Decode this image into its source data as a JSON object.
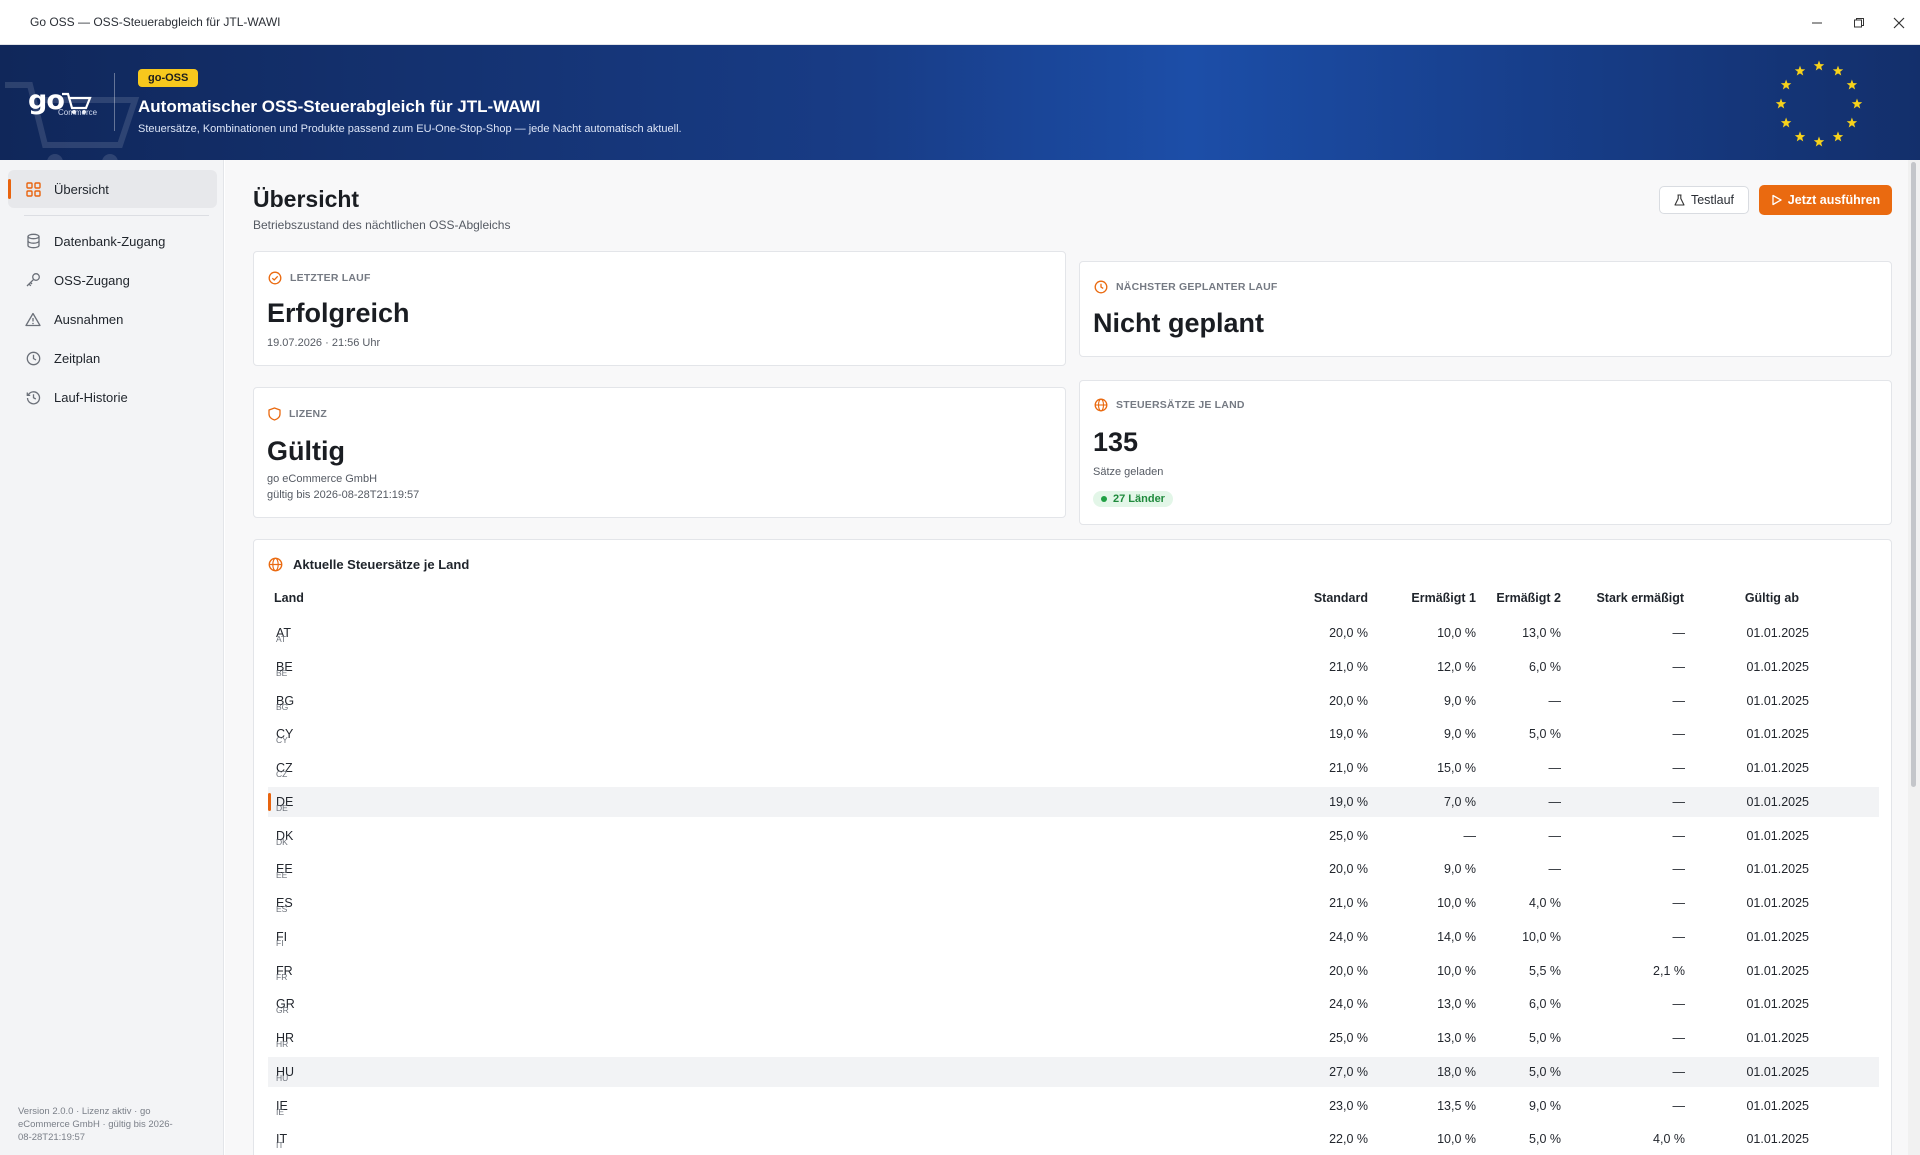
{
  "window": {
    "title": "Go OSS — OSS-Steuerabgleich für JTL-WAWI"
  },
  "banner": {
    "logo_text": "go",
    "logo_sub": "Commerce",
    "pill": "go-OSS",
    "title": "Automatischer OSS-Steuerabgleich für JTL-WAWI",
    "subtitle": "Steuersätze, Kombinationen und Produkte passend zum EU-One-Stop-Shop — jede Nacht automatisch aktuell."
  },
  "sidebar": {
    "items": [
      {
        "label": "Übersicht",
        "icon": "grid-icon",
        "active": true
      },
      {
        "label": "Datenbank-Zugang",
        "icon": "database-icon"
      },
      {
        "label": "OSS-Zugang",
        "icon": "key-icon"
      },
      {
        "label": "Ausnahmen",
        "icon": "warning-icon"
      },
      {
        "label": "Zeitplan",
        "icon": "clock-icon"
      },
      {
        "label": "Lauf-Historie",
        "icon": "history-icon"
      }
    ],
    "footer": "Version 2.0.0 · Lizenz aktiv · go eCommerce GmbH · gültig bis 2026-08-28T21:19:57"
  },
  "header": {
    "title": "Übersicht",
    "subtitle": "Betriebszustand des nächtlichen OSS-Abgleichs",
    "test_button": "Testlauf",
    "run_button": "Jetzt ausführen"
  },
  "cards": {
    "last_run": {
      "label": "LETZTER LAUF",
      "value": "Erfolgreich",
      "detail": "19.07.2026 · 21:56 Uhr"
    },
    "next_run": {
      "label": "NÄCHSTER GEPLANTER LAUF",
      "value": "Nicht geplant"
    },
    "license": {
      "label": "LIZENZ",
      "value": "Gültig",
      "company": "go eCommerce GmbH",
      "valid_until": "gültig bis 2026-08-28T21:19:57"
    },
    "rates": {
      "label": "STEUERSÄTZE JE LAND",
      "value": "135",
      "detail": "Sätze geladen",
      "badge": "27 Länder"
    }
  },
  "table": {
    "title": "Aktuelle Steuersätze je Land",
    "columns": {
      "land": "Land",
      "standard": "Standard",
      "reduced1": "Ermäßigt 1",
      "reduced2": "Ermäßigt 2",
      "super_reduced": "Stark ermäßigt",
      "valid_from": "Gültig ab"
    },
    "rows": [
      {
        "code": "AT",
        "land": "AT",
        "standard": "20,0 %",
        "reduced1": "10,0 %",
        "reduced2": "13,0 %",
        "super_reduced": "—",
        "valid_from": "01.01.2025"
      },
      {
        "code": "BE",
        "land": "BE",
        "standard": "21,0 %",
        "reduced1": "12,0 %",
        "reduced2": "6,0 %",
        "super_reduced": "—",
        "valid_from": "01.01.2025"
      },
      {
        "code": "BG",
        "land": "BG",
        "standard": "20,0 %",
        "reduced1": "9,0 %",
        "reduced2": "—",
        "super_reduced": "—",
        "valid_from": "01.01.2025"
      },
      {
        "code": "CY",
        "land": "CY",
        "standard": "19,0 %",
        "reduced1": "9,0 %",
        "reduced2": "5,0 %",
        "super_reduced": "—",
        "valid_from": "01.01.2025"
      },
      {
        "code": "CZ",
        "land": "CZ",
        "standard": "21,0 %",
        "reduced1": "15,0 %",
        "reduced2": "—",
        "super_reduced": "—",
        "valid_from": "01.01.2025"
      },
      {
        "code": "DE",
        "land": "DE",
        "standard": "19,0 %",
        "reduced1": "7,0 %",
        "reduced2": "—",
        "super_reduced": "—",
        "valid_from": "01.01.2025"
      },
      {
        "code": "DK",
        "land": "DK",
        "standard": "25,0 %",
        "reduced1": "—",
        "reduced2": "—",
        "super_reduced": "—",
        "valid_from": "01.01.2025"
      },
      {
        "code": "EE",
        "land": "EE",
        "standard": "20,0 %",
        "reduced1": "9,0 %",
        "reduced2": "—",
        "super_reduced": "—",
        "valid_from": "01.01.2025"
      },
      {
        "code": "ES",
        "land": "ES",
        "standard": "21,0 %",
        "reduced1": "10,0 %",
        "reduced2": "4,0 %",
        "super_reduced": "—",
        "valid_from": "01.01.2025"
      },
      {
        "code": "FI",
        "land": "FI",
        "standard": "24,0 %",
        "reduced1": "14,0 %",
        "reduced2": "10,0 %",
        "super_reduced": "—",
        "valid_from": "01.01.2025"
      },
      {
        "code": "FR",
        "land": "FR",
        "standard": "20,0 %",
        "reduced1": "10,0 %",
        "reduced2": "5,5 %",
        "super_reduced": "2,1 %",
        "valid_from": "01.01.2025"
      },
      {
        "code": "GR",
        "land": "GR",
        "standard": "24,0 %",
        "reduced1": "13,0 %",
        "reduced2": "6,0 %",
        "super_reduced": "—",
        "valid_from": "01.01.2025"
      },
      {
        "code": "HR",
        "land": "HR",
        "standard": "25,0 %",
        "reduced1": "13,0 %",
        "reduced2": "5,0 %",
        "super_reduced": "—",
        "valid_from": "01.01.2025"
      },
      {
        "code": "HU",
        "land": "HU",
        "standard": "27,0 %",
        "reduced1": "18,0 %",
        "reduced2": "5,0 %",
        "super_reduced": "—",
        "valid_from": "01.01.2025"
      },
      {
        "code": "IE",
        "land": "IE",
        "standard": "23,0 %",
        "reduced1": "13,5 %",
        "reduced2": "9,0 %",
        "super_reduced": "—",
        "valid_from": "01.01.2025"
      },
      {
        "code": "IT",
        "land": "IT",
        "standard": "22,0 %",
        "reduced1": "10,0 %",
        "reduced2": "5,0 %",
        "super_reduced": "4,0 %",
        "valid_from": "01.01.2025"
      }
    ]
  },
  "colors": {
    "accent": "#ea6a10",
    "banner": "#183c86",
    "pill": "#f7c81d",
    "success": "#21a044"
  }
}
